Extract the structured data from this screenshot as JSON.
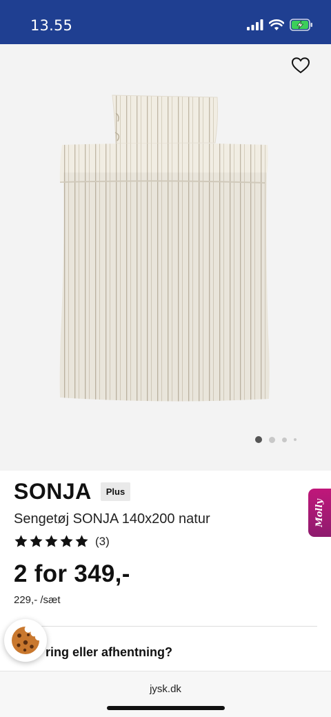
{
  "status_bar": {
    "time": "13.55",
    "icons": [
      "signal-icon",
      "wifi-icon",
      "battery-charging-icon"
    ]
  },
  "product": {
    "name": "SONJA",
    "badge": "Plus",
    "description": "Sengetøj SONJA 140x200 natur",
    "rating": 5,
    "rating_count": "(3)",
    "price": "2 for 349,-",
    "unit_price": "229,- /sæt",
    "image_icon": "striped-duvet-set-image"
  },
  "carousel": {
    "current_index": 1,
    "total": 4
  },
  "delivery": {
    "text": "ring eller afhentning?"
  },
  "molly": {
    "label": "Molly"
  },
  "browser": {
    "url": "jysk.dk"
  },
  "colors": {
    "status_bar": "#1f3f91",
    "image_background": "#f3f3f3",
    "molly_tab": "#a8197a",
    "cookie": "#c9782e"
  }
}
